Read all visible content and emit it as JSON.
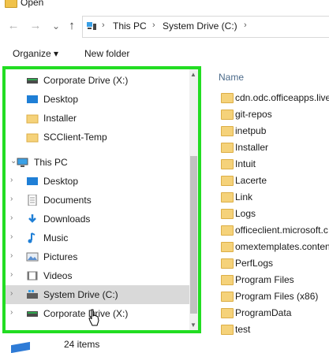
{
  "window": {
    "title": "Open"
  },
  "nav": {
    "back": "←",
    "forward": "→",
    "dropdown": "⌄",
    "up": "↑"
  },
  "address": {
    "crumbs": [
      "This PC",
      "System Drive (C:)"
    ],
    "sep": "›"
  },
  "toolbar": {
    "organize": "Organize ▾",
    "new_folder": "New folder"
  },
  "tree": [
    {
      "label": "Corporate Drive (X:)",
      "icon": "drive-icon",
      "indent": 1,
      "chev": ""
    },
    {
      "label": "Desktop",
      "icon": "desktop-icon",
      "indent": 1,
      "chev": ""
    },
    {
      "label": "Installer",
      "icon": "folder-icon",
      "indent": 1,
      "chev": ""
    },
    {
      "label": "SCClient-Temp",
      "icon": "folder-icon",
      "indent": 1,
      "chev": ""
    },
    {
      "label": "This PC",
      "icon": "pc-icon",
      "indent": 0,
      "chev": "⌄"
    },
    {
      "label": "Desktop",
      "icon": "desktop-icon",
      "indent": 1,
      "chev": "›"
    },
    {
      "label": "Documents",
      "icon": "documents-icon",
      "indent": 1,
      "chev": "›"
    },
    {
      "label": "Downloads",
      "icon": "downloads-icon",
      "indent": 1,
      "chev": "›"
    },
    {
      "label": "Music",
      "icon": "music-icon",
      "indent": 1,
      "chev": "›"
    },
    {
      "label": "Pictures",
      "icon": "pictures-icon",
      "indent": 1,
      "chev": "›"
    },
    {
      "label": "Videos",
      "icon": "videos-icon",
      "indent": 1,
      "chev": "›"
    },
    {
      "label": "System Drive (C:)",
      "icon": "system-drive-icon",
      "indent": 1,
      "chev": "›",
      "selected": true
    },
    {
      "label": "Corporate Drive (X:)",
      "icon": "drive-icon",
      "indent": 1,
      "chev": "›"
    }
  ],
  "list": {
    "header": "Name",
    "items": [
      "cdn.odc.officeapps.live",
      "git-repos",
      "inetpub",
      "Installer",
      "Intuit",
      "Lacerte",
      "Link",
      "Logs",
      "officeclient.microsoft.c",
      "omextemplates.conten",
      "PerfLogs",
      "Program Files",
      "Program Files (x86)",
      "ProgramData",
      "test"
    ]
  },
  "status": {
    "count": "24 items"
  },
  "colors": {
    "highlight": "#22dd22",
    "selected": "#d9d9d9",
    "folder": "#f5d27a"
  }
}
